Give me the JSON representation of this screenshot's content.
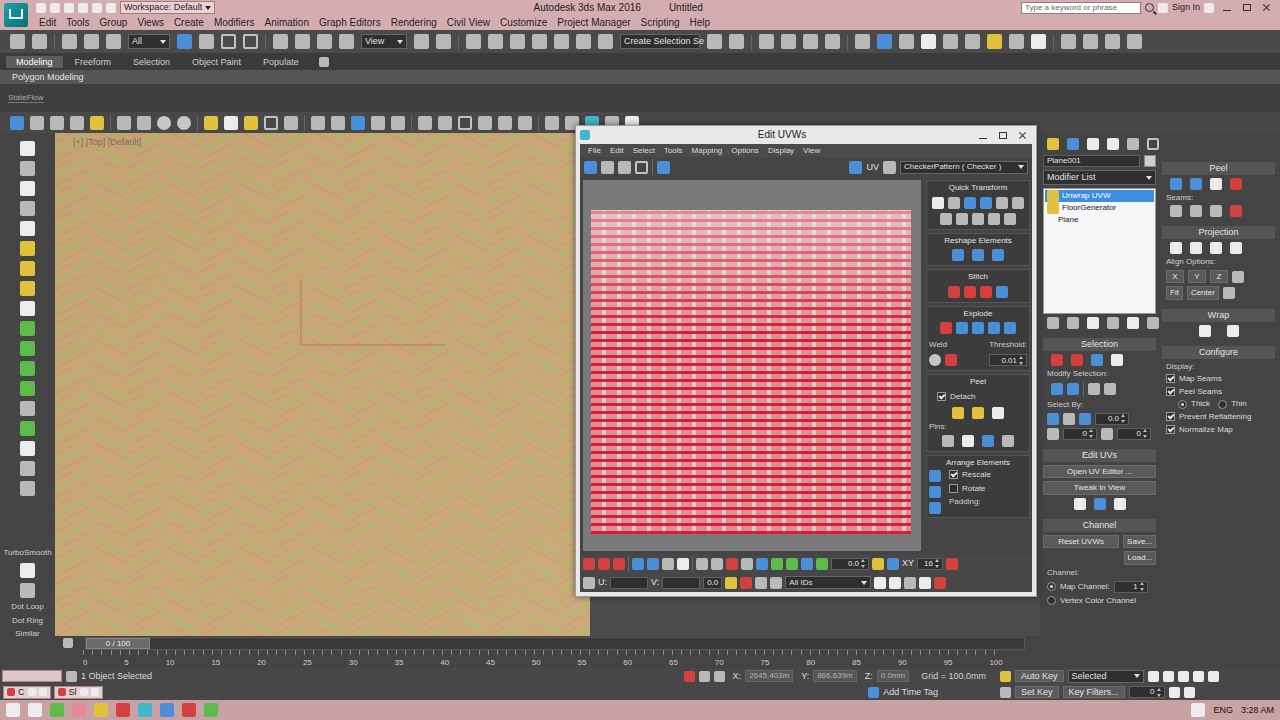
{
  "title_bar": {
    "workspace": "Workspace: Default",
    "title": "Autodesk 3ds Max 2016",
    "file": "Untitled",
    "search_placeholder": "Type a keyword or phrase",
    "sign_in": "Sign In"
  },
  "menu": [
    "Edit",
    "Tools",
    "Group",
    "Views",
    "Create",
    "Modifiers",
    "Animation",
    "Graph Editors",
    "Rendering",
    "Civil View",
    "Customize",
    "Project Manager",
    "Scripting",
    "Help"
  ],
  "main_toolbar": {
    "selection_filter": "All",
    "reference_coord": "View",
    "selection_set": "Create Selection Se"
  },
  "ribbon": {
    "tabs": [
      {
        "label": "Modeling",
        "selected": true
      },
      {
        "label": "Freeform",
        "selected": false
      },
      {
        "label": "Selection",
        "selected": false
      },
      {
        "label": "Object Paint",
        "selected": false
      },
      {
        "label": "Populate",
        "selected": false
      }
    ],
    "panel": "Polygon Modeling"
  },
  "state_bar": {
    "label": "StateFlow"
  },
  "left_toolbar": {
    "labels": [
      "TurboSmooth",
      "Dot Loop",
      "Dot Ring",
      "Similar"
    ]
  },
  "viewport": {
    "label": "[+] [Top] [Default]"
  },
  "uv_editor": {
    "title": "Edit UVWs",
    "menu": [
      "File",
      "Edit",
      "Select",
      "Tools",
      "Mapping",
      "Options",
      "Display",
      "View"
    ],
    "uv_label": "UV",
    "map": "CheckerPattern  ( Checker )",
    "quick_transform": "Quick Transform",
    "reshape": "Reshape Elements",
    "stitch": "Stitch",
    "explode": "Explode",
    "weld": "Weld",
    "threshold_label": "Threshold:",
    "threshold": "0.01",
    "peel": "Peel",
    "detach": {
      "label": "Detach",
      "checked": true
    },
    "pins": "Pins:",
    "arrange": "Arrange Elements",
    "arrange_options": [
      {
        "label": "Rescale",
        "checked": true
      },
      {
        "label": "Rotate",
        "checked": false
      }
    ],
    "padding": "Padding:",
    "spinner": "0.0",
    "axis": "XY",
    "grid_count": "16",
    "u_label": "U:",
    "v_label": "V:",
    "w_value": "0.0",
    "ids": "All IDs"
  },
  "command_panel": {
    "object_name": "Plane001",
    "modifier_list": "Modifier List",
    "stack": [
      {
        "label": "Unwrap UVW",
        "selected": true
      },
      {
        "label": "FloorGenerator",
        "selected": false
      },
      {
        "label": "Plane",
        "selected": false
      }
    ],
    "selection": {
      "title": "Selection",
      "modify": "Modify Selection:",
      "select_by": "Select By:",
      "angle": "0.0",
      "spin1": "0",
      "spin2": "0"
    },
    "edit_uvs": {
      "title": "Edit UVs",
      "open": "Open UV Editor ...",
      "tweak": "Tweak In View"
    },
    "channel": {
      "title": "Channel",
      "reset": "Reset UVWs",
      "save": "Save...",
      "load": "Load...",
      "channel_label": "Channel:",
      "sources": [
        {
          "label": "Map Channel:",
          "selected": true
        },
        {
          "label": "Vertex Color Channel",
          "selected": false
        }
      ],
      "map_value": "1"
    },
    "peel": {
      "title": "Peel",
      "seams": "Seams:"
    },
    "projection": {
      "title": "Projection",
      "align": "Align Options:",
      "axes": [
        "X",
        "Y",
        "Z"
      ],
      "fit": "Fit",
      "center": "Center"
    },
    "wrap": {
      "title": "Wrap"
    },
    "configure": {
      "title": "Configure",
      "display": "Display:",
      "checks": [
        {
          "label": "Map Seams",
          "checked": true
        },
        {
          "label": "Peel Seams",
          "checked": true
        }
      ],
      "thickness": [
        {
          "label": "Thick",
          "selected": true
        },
        {
          "label": "Thin",
          "selected": false
        }
      ],
      "options": [
        {
          "label": "Prevent Reflattening",
          "checked": true
        },
        {
          "label": "Normalize Map",
          "checked": true
        }
      ]
    }
  },
  "timeline": {
    "position": "0 / 100",
    "level": 0,
    "ticks": [
      "0",
      "5",
      "10",
      "15",
      "20",
      "25",
      "30",
      "35",
      "40",
      "45",
      "50",
      "55",
      "60",
      "65",
      "70",
      "75",
      "80",
      "85",
      "90",
      "95",
      "100"
    ]
  },
  "status_bar": {
    "script_tabs": [
      "C",
      "Sl"
    ],
    "selected": "1 Object Selected",
    "coords": [
      {
        "label": "X:",
        "value": "2645.403m"
      },
      {
        "label": "Y:",
        "value": "866.639m"
      },
      {
        "label": "Z:",
        "value": "0.0mm"
      }
    ],
    "grid": "Grid = 100.0mm",
    "time_tag": "Add Time Tag",
    "auto_key": "Auto Key",
    "key_mode": "Selected",
    "set_key": "Set Key",
    "key_filters": "Key Filters...",
    "frame": "0"
  },
  "taskbar": {
    "language": "ENG",
    "time": "3:28 AM"
  }
}
